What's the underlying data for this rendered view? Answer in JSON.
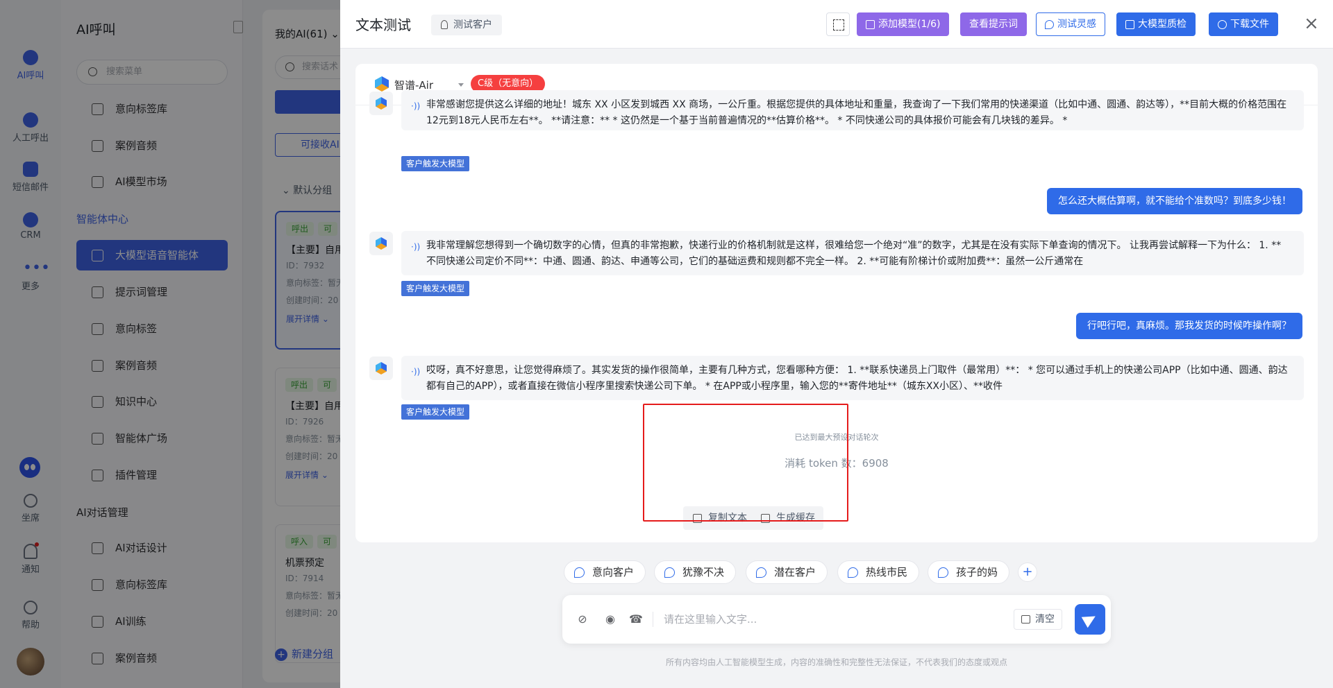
{
  "rail": {
    "items": [
      {
        "label": "AI呼叫"
      },
      {
        "label": "人工呼出"
      },
      {
        "label": "短信邮件"
      },
      {
        "label": "CRM"
      },
      {
        "label": "更多"
      },
      {
        "label": "坐席"
      },
      {
        "label": "通知"
      },
      {
        "label": "帮助"
      }
    ]
  },
  "menu": {
    "title": "AI呼叫",
    "search_placeholder": "搜索菜单",
    "items_top": [
      "意向标签库",
      "案例音频",
      "AI模型市场"
    ],
    "section_agent": "智能体中心",
    "items_agent": [
      "大模型语音智能体",
      "提示词管理",
      "意向标签",
      "案例音频",
      "知识中心",
      "智能体广场",
      "插件管理"
    ],
    "section_dialog": "AI对话管理",
    "items_dialog": [
      "AI对话设计",
      "意向标签库",
      "AI训练",
      "案例音频"
    ]
  },
  "mid": {
    "header": "我的AI(61)",
    "search_placeholder": "搜索话术",
    "receivable": "可接收AI",
    "group": "默认分组",
    "cards": [
      {
        "tag1": "呼出",
        "tag2": "可",
        "title": "【主要】自用",
        "id": "ID：7932",
        "line1": "意向标签：暂无",
        "line2": "创建时间：20",
        "more": "展开详情"
      },
      {
        "tag1": "呼出",
        "tag2": "可",
        "title": "【主要】自用",
        "id": "ID：7926",
        "line1": "意向标签：暂无",
        "line2": "创建时间：20",
        "more": "展开详情"
      },
      {
        "tag1": "呼入",
        "tag2": "可",
        "title": "机票预定",
        "id": "ID：7914",
        "line1": "意向标签：暂无",
        "line2": "创建时间：20",
        "more": "展开详情"
      }
    ],
    "new_group": "新建分组"
  },
  "drawer": {
    "title": "文本测试",
    "customer_tag": "测试客户",
    "buttons": {
      "add_model": "添加模型(1/6)",
      "view_prompt": "查看提示词",
      "test_inspiration": "测试灵感",
      "quality_check": "大模型质检",
      "download": "下载文件"
    },
    "close": "×",
    "model": {
      "name": "智谱-Air",
      "grade": "C级（无意向）"
    },
    "messages": [
      {
        "role": "bot",
        "text": "非常感谢您提供这么详细的地址！城东 XX 小区发到城西 XX 商场，一公斤重。根据您提供的具体地址和重量，我查询了一下我们常用的快递渠道（比如中通、圆通、韵达等），**目前大概的价格范围在 12元到18元人民币左右**。 **请注意：** * 这仍然是一个基于当前普遍情况的**估算价格**。 * 不同快递公司的具体报价可能会有几块钱的差异。 *",
        "trigger": "客户触发大模型"
      },
      {
        "role": "user",
        "text": "怎么还大概估算啊，就不能给个准数吗？到底多少钱！"
      },
      {
        "role": "bot",
        "text": "我非常理解您想得到一个确切数字的心情，但真的非常抱歉，快递行业的价格机制就是这样，很难给您一个绝对“准”的数字，尤其是在没有实际下单查询的情况下。 让我再尝试解释一下为什么： 1. **不同快递公司定价不同**：中通、圆通、韵达、申通等公司，它们的基础运费和规则都不完全一样。 2. **可能有阶梯计价或附加费**：虽然一公斤通常在",
        "trigger": "客户触发大模型"
      },
      {
        "role": "user",
        "text": "行吧行吧，真麻烦。那我发货的时候咋操作啊？"
      },
      {
        "role": "bot",
        "text": "哎呀，真不好意思，让您觉得麻烦了。其实发货的操作很简单，主要有几种方式，您看哪种方便： 1. **联系快递员上门取件（最常用）**： * 您可以通过手机上的快递公司APP（比如中通、圆通、韵达都有自己的APP），或者直接在微信小程序里搜索快递公司下单。 * 在APP或小程序里，输入您的**寄件地址**（城东XX小区）、**收件",
        "trigger": "客户触发大模型"
      }
    ],
    "end_note": "已达到最大预设对话轮次",
    "token_note": "消耗 token 数：6908",
    "actions": {
      "copy": "复制文本",
      "cache": "生成缓存"
    },
    "chips": [
      "意向客户",
      "犹豫不决",
      "潜在客户",
      "热线市民",
      "孩子的妈"
    ],
    "chip_add": "+",
    "input_placeholder": "请在这里输入文字...",
    "clear": "清空",
    "disclaimer": "所有内容均由人工智能模型生成，内容的准确性和完整性无法保证，不代表我们的态度或观点"
  },
  "colors": {
    "primary": "#2f6be8",
    "purple": "#8e68e8",
    "grade_red": "#f53f3f",
    "highlight_box": "#e51b1b"
  }
}
